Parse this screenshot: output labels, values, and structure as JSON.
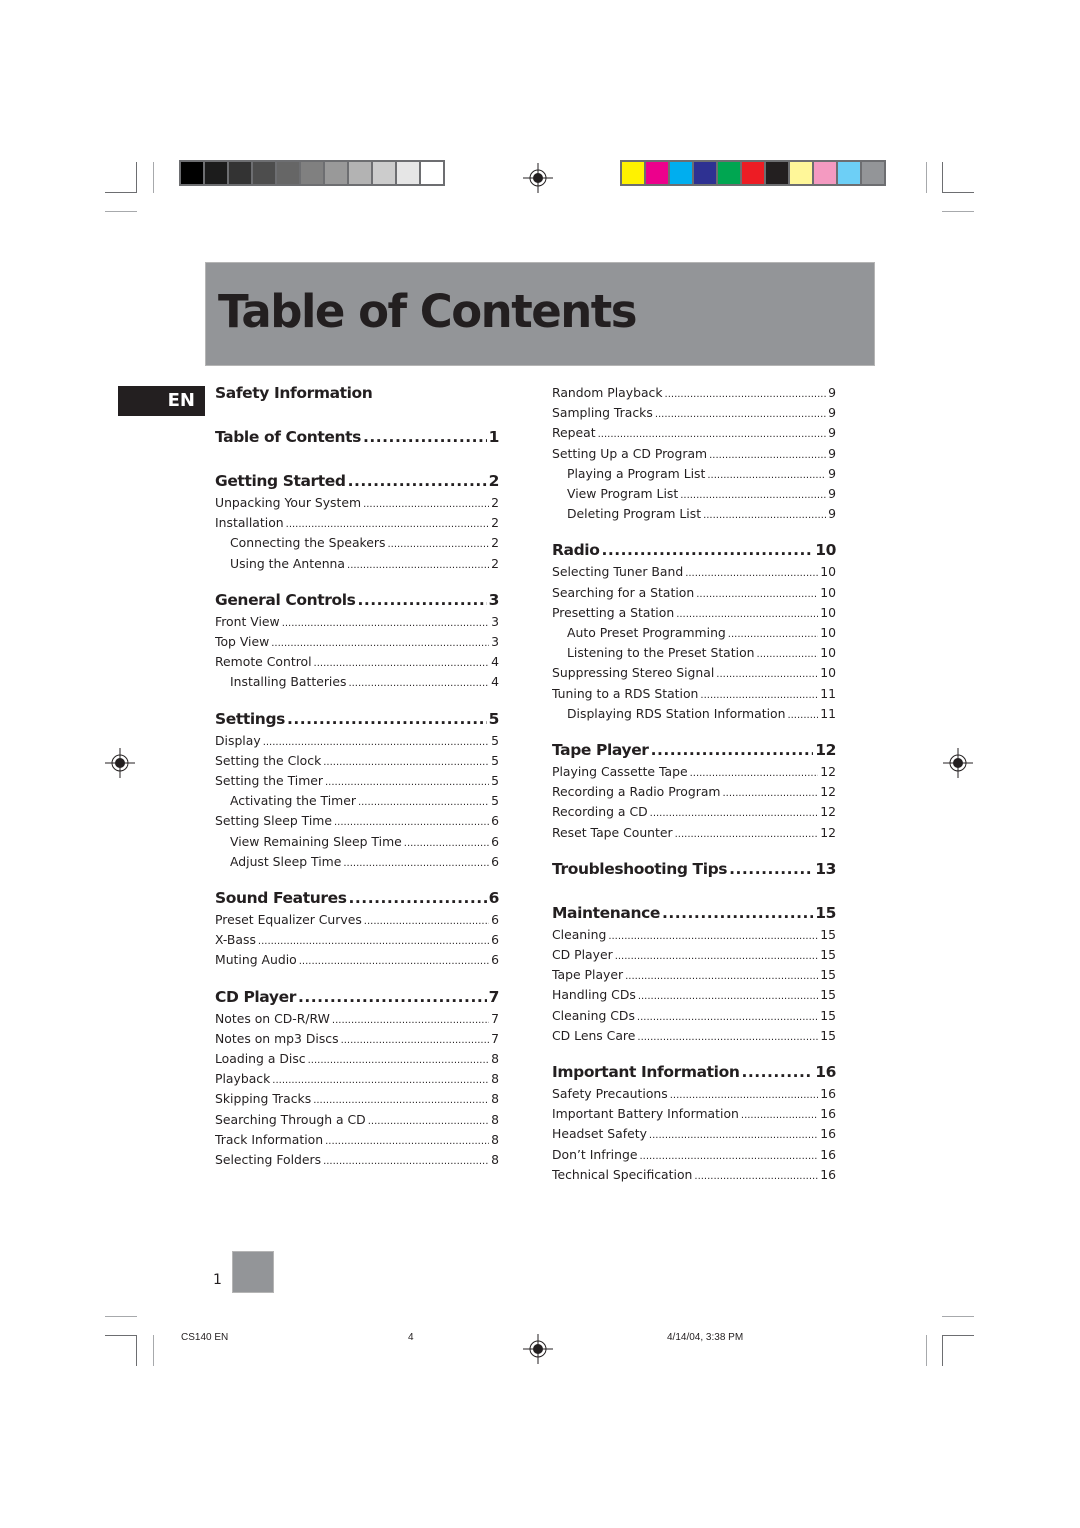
{
  "page": {
    "title": "Table of Contents",
    "language_tab": "EN",
    "page_number": "1"
  },
  "color_bars": {
    "grayscale": [
      "#000000",
      "#1c1c1c",
      "#333333",
      "#4d4d4d",
      "#666666",
      "#808080",
      "#999999",
      "#b3b3b3",
      "#cccccc",
      "#e6e6e6",
      "#ffffff"
    ],
    "process": [
      "#fff200",
      "#ec008c",
      "#00aeef",
      "#2e3192",
      "#00a651",
      "#ed1c24",
      "#231f20",
      "#fff799",
      "#f49ac1",
      "#6dcff6",
      "#939598"
    ]
  },
  "left_column": [
    {
      "title": "Safety Information",
      "page": "",
      "entries": []
    },
    {
      "title": "Table of Contents",
      "page": "1",
      "entries": []
    },
    {
      "title": "Getting Started",
      "page": "2",
      "entries": [
        {
          "label": "Unpacking Your System",
          "page": "2",
          "sub": false
        },
        {
          "label": "Installation",
          "page": "2",
          "sub": false
        },
        {
          "label": "Connecting the Speakers",
          "page": "2",
          "sub": true
        },
        {
          "label": "Using the Antenna",
          "page": "2",
          "sub": true
        }
      ]
    },
    {
      "title": "General Controls",
      "page": "3",
      "entries": [
        {
          "label": "Front View",
          "page": "3",
          "sub": false
        },
        {
          "label": "Top View",
          "page": "3",
          "sub": false
        },
        {
          "label": "Remote Control",
          "page": "4",
          "sub": false
        },
        {
          "label": "Installing Batteries",
          "page": "4",
          "sub": true
        }
      ]
    },
    {
      "title": "Settings",
      "page": "5",
      "entries": [
        {
          "label": "Display",
          "page": "5",
          "sub": false
        },
        {
          "label": "Setting the Clock",
          "page": "5",
          "sub": false
        },
        {
          "label": "Setting the Timer",
          "page": "5",
          "sub": false
        },
        {
          "label": "Activating the Timer",
          "page": "5",
          "sub": true
        },
        {
          "label": "Setting Sleep Time",
          "page": "6",
          "sub": false
        },
        {
          "label": "View Remaining Sleep Time",
          "page": "6",
          "sub": true
        },
        {
          "label": "Adjust Sleep Time",
          "page": "6",
          "sub": true
        }
      ]
    },
    {
      "title": "Sound Features",
      "page": "6",
      "entries": [
        {
          "label": "Preset Equalizer Curves",
          "page": "6",
          "sub": false
        },
        {
          "label": "X-Bass",
          "page": "6",
          "sub": false
        },
        {
          "label": "Muting Audio",
          "page": "6",
          "sub": false
        }
      ]
    },
    {
      "title": "CD Player",
      "page": "7",
      "entries": [
        {
          "label": "Notes on CD-R/RW",
          "page": "7",
          "sub": false
        },
        {
          "label": "Notes on mp3 Discs",
          "page": "7",
          "sub": false
        },
        {
          "label": "Loading a Disc",
          "page": "8",
          "sub": false
        },
        {
          "label": "Playback",
          "page": "8",
          "sub": false
        },
        {
          "label": "Skipping Tracks",
          "page": "8",
          "sub": false
        },
        {
          "label": "Searching Through a CD",
          "page": "8",
          "sub": false
        },
        {
          "label": "Track Information",
          "page": "8",
          "sub": false
        },
        {
          "label": "Selecting Folders",
          "page": "8",
          "sub": false
        }
      ]
    }
  ],
  "right_column": [
    {
      "title": "",
      "page": "",
      "entries": [
        {
          "label": "Random Playback",
          "page": "9",
          "sub": false
        },
        {
          "label": "Sampling Tracks",
          "page": "9",
          "sub": false
        },
        {
          "label": "Repeat",
          "page": "9",
          "sub": false
        },
        {
          "label": "Setting Up a CD Program",
          "page": "9",
          "sub": false
        },
        {
          "label": "Playing a Program List",
          "page": "9",
          "sub": true
        },
        {
          "label": "View Program List",
          "page": "9",
          "sub": true
        },
        {
          "label": "Deleting Program List",
          "page": "9",
          "sub": true
        }
      ]
    },
    {
      "title": "Radio",
      "page": "10",
      "entries": [
        {
          "label": "Selecting Tuner Band",
          "page": "10",
          "sub": false
        },
        {
          "label": "Searching for a Station",
          "page": "10",
          "sub": false
        },
        {
          "label": "Presetting a Station",
          "page": "10",
          "sub": false
        },
        {
          "label": "Auto Preset Programming",
          "page": "10",
          "sub": true
        },
        {
          "label": "Listening to the Preset Station",
          "page": "10",
          "sub": true
        },
        {
          "label": "Suppressing Stereo Signal",
          "page": "10",
          "sub": false
        },
        {
          "label": "Tuning to a RDS Station",
          "page": "11",
          "sub": false
        },
        {
          "label": "Displaying RDS Station Information",
          "page": "11",
          "sub": true
        }
      ]
    },
    {
      "title": "Tape Player",
      "page": "12",
      "entries": [
        {
          "label": "Playing Cassette Tape",
          "page": "12",
          "sub": false
        },
        {
          "label": "Recording a Radio Program",
          "page": "12",
          "sub": false
        },
        {
          "label": "Recording a CD",
          "page": "12",
          "sub": false
        },
        {
          "label": "Reset Tape Counter",
          "page": "12",
          "sub": false
        }
      ]
    },
    {
      "title": "Troubleshooting Tips",
      "page": "13",
      "entries": []
    },
    {
      "title": "Maintenance",
      "page": "15",
      "entries": [
        {
          "label": "Cleaning",
          "page": "15",
          "sub": false
        },
        {
          "label": "CD Player",
          "page": "15",
          "sub": false
        },
        {
          "label": "Tape Player",
          "page": "15",
          "sub": false
        },
        {
          "label": "Handling CDs",
          "page": "15",
          "sub": false
        },
        {
          "label": "Cleaning CDs",
          "page": "15",
          "sub": false
        },
        {
          "label": "CD Lens Care",
          "page": "15",
          "sub": false
        }
      ]
    },
    {
      "title": "Important Information",
      "page": "16",
      "entries": [
        {
          "label": "Safety Precautions",
          "page": "16",
          "sub": false
        },
        {
          "label": "Important Battery Information",
          "page": "16",
          "sub": false
        },
        {
          "label": "Headset Safety",
          "page": "16",
          "sub": false
        },
        {
          "label": "Don’t Infringe",
          "page": "16",
          "sub": false
        },
        {
          "label": "Technical Specification",
          "page": "16",
          "sub": false
        }
      ]
    }
  ],
  "slug": {
    "file": "CS140 EN",
    "sheet": "4",
    "timestamp": "4/14/04, 3:38 PM"
  }
}
